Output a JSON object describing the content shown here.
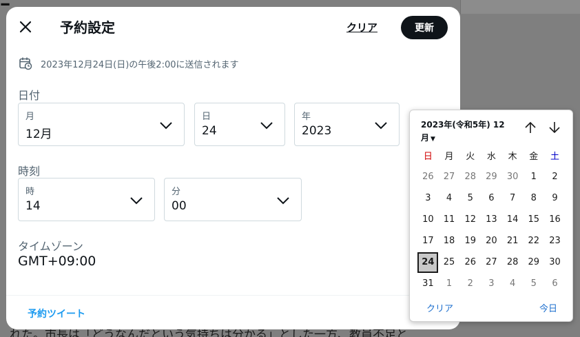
{
  "modal": {
    "title": "予約設定",
    "clear_label": "クリア",
    "update_label": "更新",
    "send_info": "2023年12月24日(日)の午後2:00に送信されます",
    "date_section": "日付",
    "month": {
      "label": "月",
      "value": "12月"
    },
    "day": {
      "label": "日",
      "value": "24"
    },
    "year": {
      "label": "年",
      "value": "2023"
    },
    "time_section": "時刻",
    "hour": {
      "label": "時",
      "value": "14"
    },
    "minute": {
      "label": "分",
      "value": "00"
    },
    "timezone_label": "タイムゾーン",
    "timezone_value": "GMT+09:00",
    "footer_link": "予約ツイート"
  },
  "calendar": {
    "month_title": "2023年(令和5年) 12月",
    "weekdays": [
      "日",
      "月",
      "火",
      "水",
      "木",
      "金",
      "土"
    ],
    "weekday_colors": {
      "sunday": "#d00000",
      "saturday": "#0000c8"
    },
    "days": [
      [
        "26",
        "27",
        "28",
        "29",
        "30",
        "1",
        "2"
      ],
      [
        "3",
        "4",
        "5",
        "6",
        "7",
        "8",
        "9"
      ],
      [
        "10",
        "11",
        "12",
        "13",
        "14",
        "15",
        "16"
      ],
      [
        "17",
        "18",
        "19",
        "20",
        "21",
        "22",
        "23"
      ],
      [
        "24",
        "25",
        "26",
        "27",
        "28",
        "29",
        "30"
      ],
      [
        "31",
        "1",
        "2",
        "3",
        "4",
        "5",
        "6"
      ]
    ],
    "other_month": [
      [
        true,
        true,
        true,
        true,
        true,
        false,
        false
      ],
      [
        false,
        false,
        false,
        false,
        false,
        false,
        false
      ],
      [
        false,
        false,
        false,
        false,
        false,
        false,
        false
      ],
      [
        false,
        false,
        false,
        false,
        false,
        false,
        false
      ],
      [
        false,
        false,
        false,
        false,
        false,
        false,
        false
      ],
      [
        false,
        true,
        true,
        true,
        true,
        true,
        true
      ]
    ],
    "selected_day": "24",
    "clear_label": "クリア",
    "today_label": "今日"
  },
  "background": {
    "bottom_text": "れた。市長は「どうなんだという気持ちは分かる」とした一方、教員不足と"
  },
  "colors": {
    "accent": "#1d9bf0",
    "primary_button": "#0f1419"
  }
}
